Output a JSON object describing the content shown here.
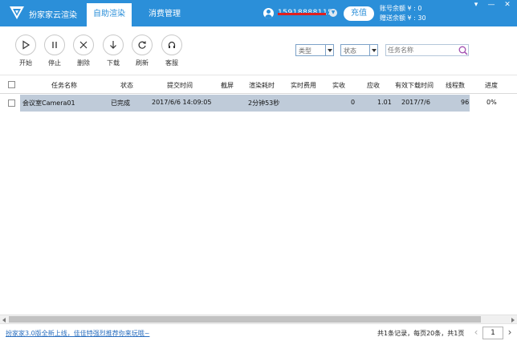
{
  "app": {
    "title": "扮家家云渲染",
    "tabs": [
      {
        "label": "自助渲染",
        "active": true
      },
      {
        "label": "消费管理",
        "active": false
      }
    ],
    "accent_color": "#2b8fd9"
  },
  "account": {
    "phone": "15918888115",
    "vip_icon": "vip-badge-icon",
    "recharge_label": "充值",
    "balance_label": "账号余额 ¥ : 0",
    "gift_label": "赠送余额 ¥ : 30"
  },
  "window_controls": {
    "menu": "▾",
    "minimize": "—",
    "close": "✕"
  },
  "toolbar": {
    "actions": [
      {
        "label": "开始",
        "icon": "play-icon"
      },
      {
        "label": "停止",
        "icon": "pause-icon"
      },
      {
        "label": "删除",
        "icon": "close-icon"
      },
      {
        "label": "下载",
        "icon": "download-arrow-icon"
      },
      {
        "label": "刷新",
        "icon": "refresh-icon"
      },
      {
        "label": "客服",
        "icon": "headset-icon"
      }
    ],
    "type_select": "类型",
    "status_select": "状态",
    "search_placeholder": "任务名称"
  },
  "table": {
    "columns": [
      "任务名称",
      "状态",
      "提交时间",
      "截屏",
      "渲染耗时",
      "实时费用",
      "实收",
      "应收",
      "有效下载时间",
      "线程数",
      "进度"
    ],
    "rows": [
      {
        "name": "会议室Camera01",
        "status": "已完成",
        "submit_time": "2017/6/6 14:09:05",
        "screenshot": "",
        "render_time": "2分钟53秒",
        "realtime_cost": "",
        "received": "0",
        "receivable": "1.01",
        "download_until": "2017/7/6",
        "threads": "96",
        "progress": "0%",
        "selected": true
      }
    ]
  },
  "footer": {
    "promo": "扮家家3.0版全新上线，佳佳特强烈推荐你来玩哦~",
    "pager_info": "共1条记录，每页20条，共1页",
    "prev": "‹",
    "page": "1",
    "next": "›"
  }
}
